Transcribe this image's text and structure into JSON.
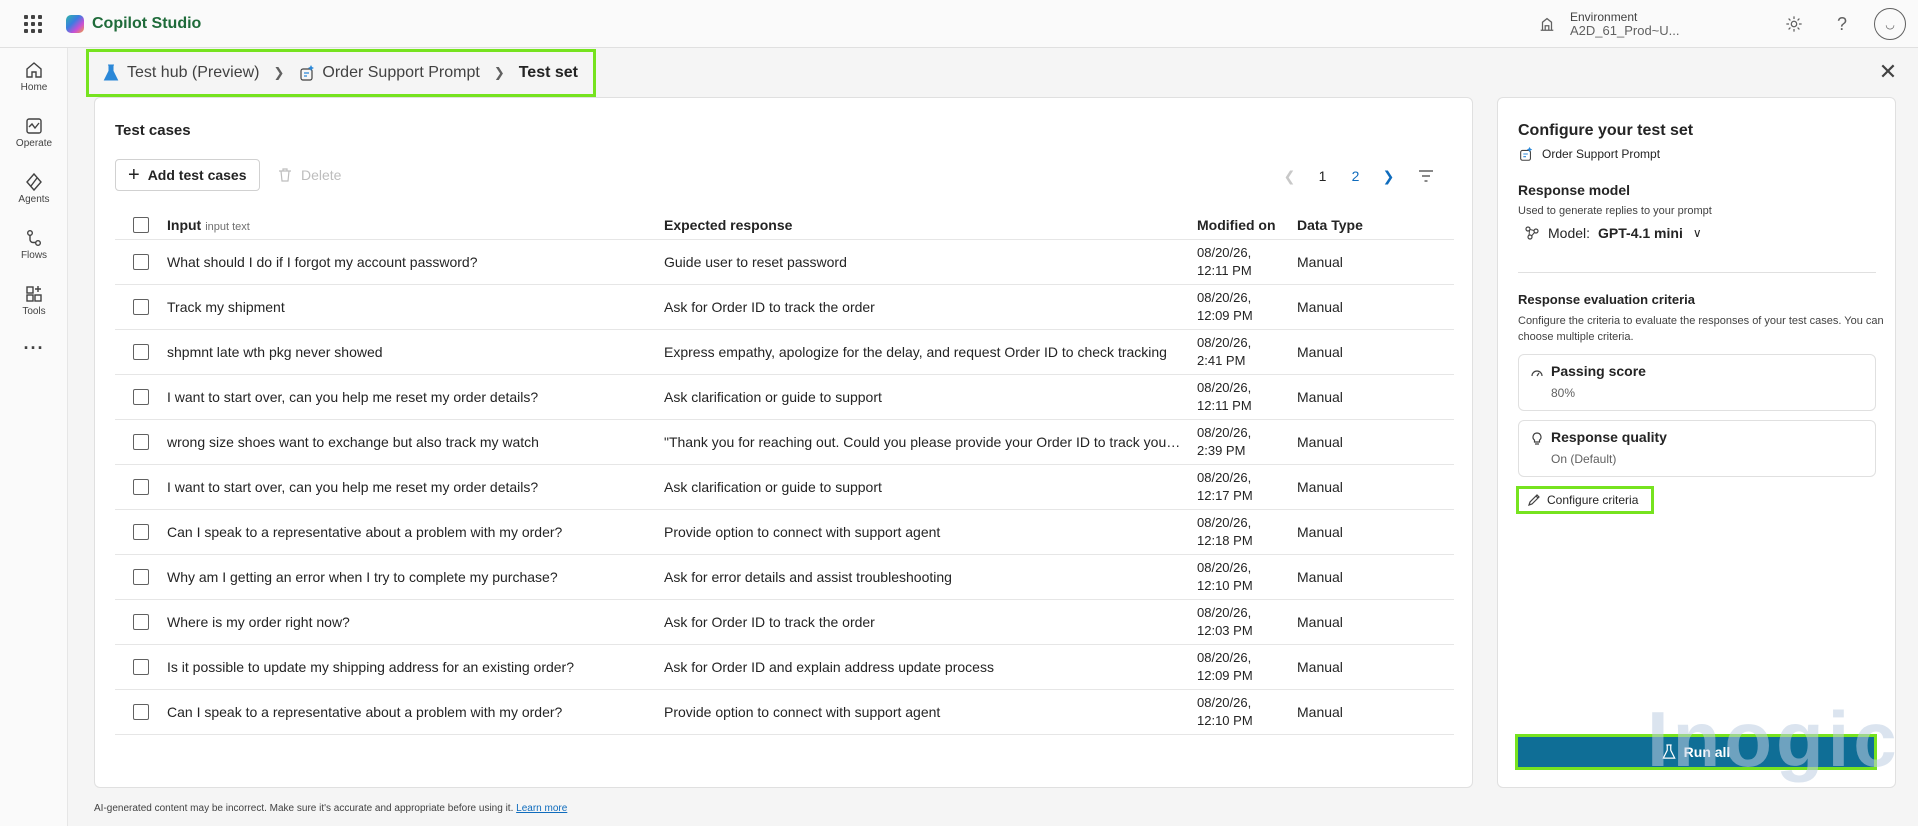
{
  "app": {
    "name": "Copilot Studio"
  },
  "environment": {
    "label": "Environment",
    "value": "A2D_61_Prod~U..."
  },
  "nav": [
    {
      "label": "Home",
      "icon": "home-icon"
    },
    {
      "label": "Operate",
      "icon": "operate-icon"
    },
    {
      "label": "Agents",
      "icon": "agents-icon"
    },
    {
      "label": "Flows",
      "icon": "flows-icon"
    },
    {
      "label": "Tools",
      "icon": "tools-icon"
    }
  ],
  "breadcrumb": {
    "hub": "Test hub (Preview)",
    "prompt": "Order Support Prompt",
    "current": "Test set"
  },
  "main": {
    "title": "Test cases",
    "add_label": "Add test cases",
    "delete_label": "Delete",
    "pager": {
      "page1": "1",
      "page2": "2"
    },
    "columns": {
      "input": "Input",
      "input_hint": "input text",
      "expected": "Expected response",
      "modified": "Modified on",
      "type": "Data Type"
    },
    "rows": [
      {
        "input": "What should I do if I forgot my account password?",
        "expected": "Guide user to reset password",
        "date": "08/20/26,",
        "time": "12:11 PM",
        "type": "Manual"
      },
      {
        "input": "Track my shipment",
        "expected": "Ask for Order ID to track the order",
        "date": "08/20/26,",
        "time": "12:09 PM",
        "type": "Manual"
      },
      {
        "input": "shpmnt late wth pkg never showed",
        "expected": "Express empathy, apologize for the delay, and request Order ID to check tracking",
        "date": "08/20/26,",
        "time": "2:41 PM",
        "type": "Manual"
      },
      {
        "input": "I want to start over, can you help me reset my order details?",
        "expected": "Ask clarification or guide to support",
        "date": "08/20/26,",
        "time": "12:11 PM",
        "type": "Manual"
      },
      {
        "input": "wrong size shoes want to exchange but also track my watch",
        "expected": "\"Thank you for reaching out. Could you please provide your Order ID to track your watch",
        "date": "08/20/26,",
        "time": "2:39 PM",
        "type": "Manual"
      },
      {
        "input": "I want to start over, can you help me reset my order details?",
        "expected": "Ask clarification or guide to support",
        "date": "08/20/26,",
        "time": "12:17 PM",
        "type": "Manual"
      },
      {
        "input": "Can I speak to a representative about a problem with my order?",
        "expected": "Provide option to connect with support agent",
        "date": "08/20/26,",
        "time": "12:18 PM",
        "type": "Manual"
      },
      {
        "input": "Why am I getting an error when I try to complete my purchase?",
        "expected": "Ask for error details and assist troubleshooting",
        "date": "08/20/26,",
        "time": "12:10 PM",
        "type": "Manual"
      },
      {
        "input": "Where is my order right now?",
        "expected": "Ask for Order ID to track the order",
        "date": "08/20/26,",
        "time": "12:03 PM",
        "type": "Manual"
      },
      {
        "input": "Is it possible to update my shipping address for an existing order?",
        "expected": "Ask for Order ID and explain address update process",
        "date": "08/20/26,",
        "time": "12:09 PM",
        "type": "Manual"
      },
      {
        "input": "Can I speak to a representative about a problem with my order?",
        "expected": "Provide option to connect with support agent",
        "date": "08/20/26,",
        "time": "12:10 PM",
        "type": "Manual"
      }
    ]
  },
  "side": {
    "title": "Configure your test set",
    "prompt_name": "Order Support Prompt",
    "model_title": "Response model",
    "model_desc": "Used to generate replies to your prompt",
    "model_label": "Model:",
    "model_value": "GPT-4.1 mini",
    "criteria_title": "Response evaluation criteria",
    "criteria_desc": "Configure the criteria to evaluate the responses of your test cases. You can choose multiple criteria.",
    "criteria": [
      {
        "name": "Passing score",
        "value": "80%"
      },
      {
        "name": "Response quality",
        "value": "On (Default)"
      }
    ],
    "configure_label": "Configure criteria",
    "run_label": "Run all"
  },
  "footer": {
    "note": "AI-generated content may be incorrect. Make sure it's accurate and appropriate before using it.",
    "link": "Learn more"
  },
  "watermark": "Inogic",
  "colors": {
    "accent": "#0f6e96",
    "highlight": "#76e31f",
    "link": "#0f6cbd",
    "brand_text": "#1f6b3a"
  }
}
